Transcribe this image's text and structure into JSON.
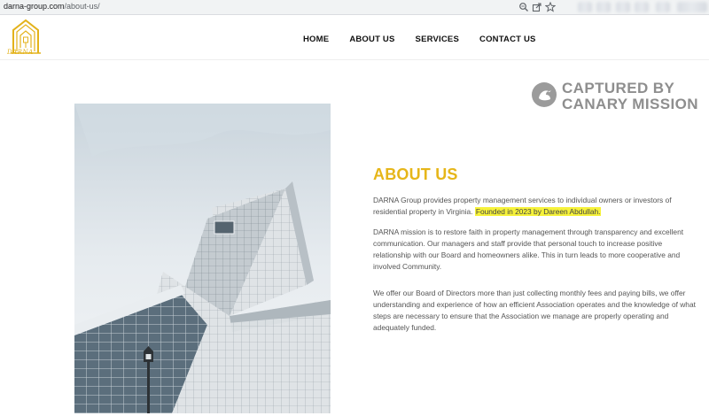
{
  "browser": {
    "url_host": "darna-group.com",
    "url_path": "/about-us/"
  },
  "site": {
    "logo_text": "DARNA",
    "nav": [
      {
        "label": "HOME"
      },
      {
        "label": "ABOUT US"
      },
      {
        "label": "SERVICES"
      },
      {
        "label": "CONTACT US"
      }
    ]
  },
  "watermark": {
    "line1": "CAPTURED BY",
    "line2": "CANARY MISSION"
  },
  "about": {
    "title": "ABOUT US",
    "p1_text": "DARNA Group provides property management  services to individual owners or investors of residential property in Virginia.",
    "p1_highlight": "Founded in 2023 by Dareen Abdullah.",
    "p2": "DARNA mission is to restore faith in property management through transparency and excellent communication. Our managers and staff provide that personal touch to increase positive relationship with our Board and homeowners alike. This in turn leads to more cooperative and involved Community.",
    "p3": "We offer our Board of Directors more than just collecting monthly fees and paying bills, we offer understanding and experience of how an efficient Association operates and the knowledge of what steps are necessary to ensure that the Association we manage are properly operating and adequately funded."
  },
  "colors": {
    "accent": "#e6b619",
    "highlight": "#f6f23a",
    "watermark": "#8e8e8e"
  }
}
